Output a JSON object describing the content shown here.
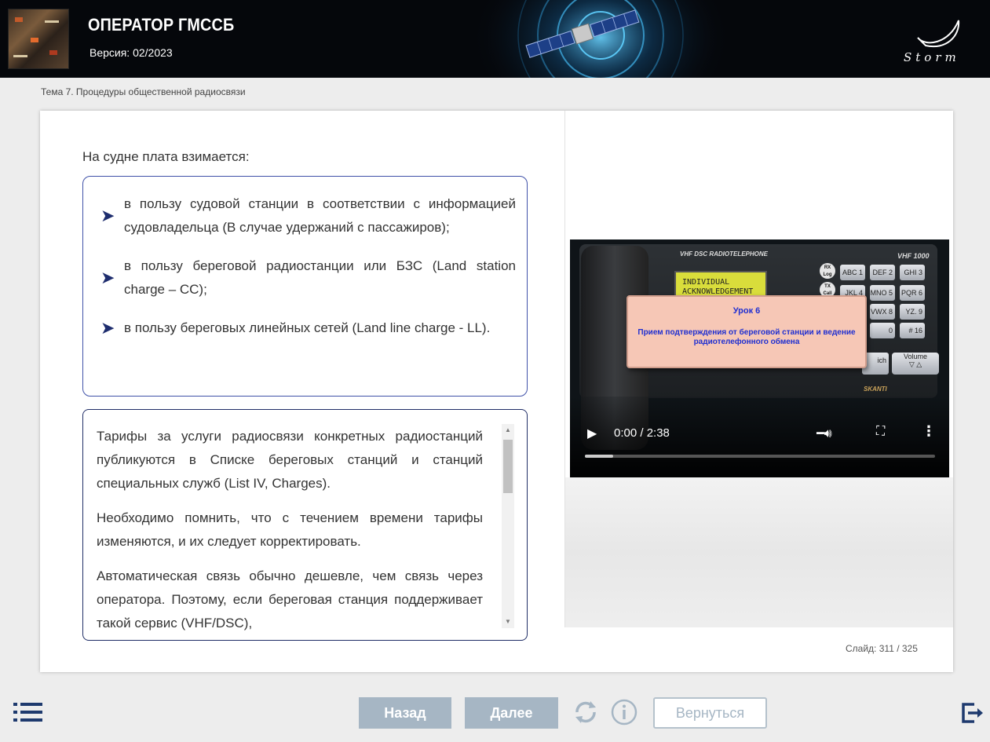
{
  "header": {
    "title": "ОПЕРАТОР ГМССБ",
    "version": "Версия: 02/2023",
    "logo_text": "Storm"
  },
  "breadcrumb": "Тема 7. Процедуры общественной радиосвязи",
  "slide": {
    "intro": "На судне плата взимается:",
    "bullets": [
      "в пользу судовой станции в соответствии с информацией судовладельца (В случае удержаний с пассажиров);",
      "в пользу береговой радиостанции или БЗС (Land station charge – CC);",
      "в пользу береговых линейных сетей (Land line charge - LL)."
    ],
    "paragraphs": [
      "Тарифы за услуги радиосвязи конкретных радиостанций публикуются в Списке береговых станций и станций специальных служб (List IV, Charges).",
      "Необходимо помнить, что с течением времени тарифы изменяются, и их следует корректировать.",
      "Автоматическая связь обычно дешевле, чем связь через оператора. Поэтому, если береговая станция поддерживает такой сервис (VHF/DSC),"
    ],
    "counter_label": "Слайд:",
    "counter_value": "311 / 325"
  },
  "video": {
    "device_label": "VHF DSC RADIOTELEPHONE",
    "model": "VHF 1000",
    "brand": "SKANTI",
    "lcd_line1": "INDIVIDUAL",
    "lcd_line2": "ACKNOWLEDGEMENT",
    "lesson_title": "Урок 6",
    "lesson_subtitle": "Прием подтверждения от береговой станции и ведение радиотелефонного обмена",
    "time": "0:00 / 2:38",
    "progress": 0.08,
    "key_rx": "RX Log",
    "key_tx": "TX Call",
    "keys": [
      "ABC 1",
      "DEF 2",
      "GHI 3",
      "JKL 4",
      "MNO 5",
      "PQR 6",
      "VWX 8",
      "YZ. 9",
      "0",
      "# 16"
    ],
    "volume_label": "Volume",
    "ich_label": "ich"
  },
  "footer": {
    "back_label": "Назад",
    "next_label": "Далее",
    "return_label": "Вернуться"
  },
  "colors": {
    "accent_border": "#3f51a8",
    "button_bg": "#a6b6c4",
    "lesson_text": "#1f2fd1"
  }
}
